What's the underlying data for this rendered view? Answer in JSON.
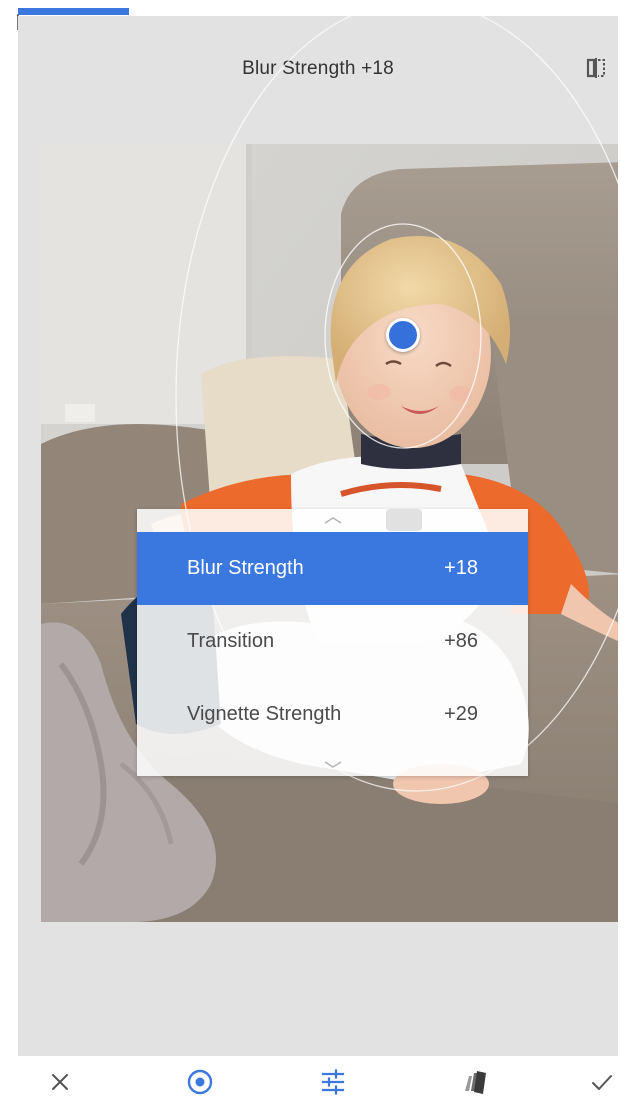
{
  "header": {
    "title": "Blur Strength +18"
  },
  "icons": {
    "compare": "compare-icon",
    "cancel": "close-icon",
    "focus": "target-icon",
    "adjust": "tune-sliders-icon",
    "styles": "style-cards-icon",
    "apply": "check-icon"
  },
  "params_menu": {
    "items": [
      {
        "label": "Blur Strength",
        "value": "+18",
        "active": true
      },
      {
        "label": "Transition",
        "value": "+86",
        "active": false
      },
      {
        "label": "Vignette Strength",
        "value": "+29",
        "active": false
      }
    ]
  },
  "colors": {
    "accent": "#3a78e0",
    "canvas_bg": "#e2e2e2",
    "menu_text": "#4a4a4a",
    "icon_gray": "#555555"
  }
}
